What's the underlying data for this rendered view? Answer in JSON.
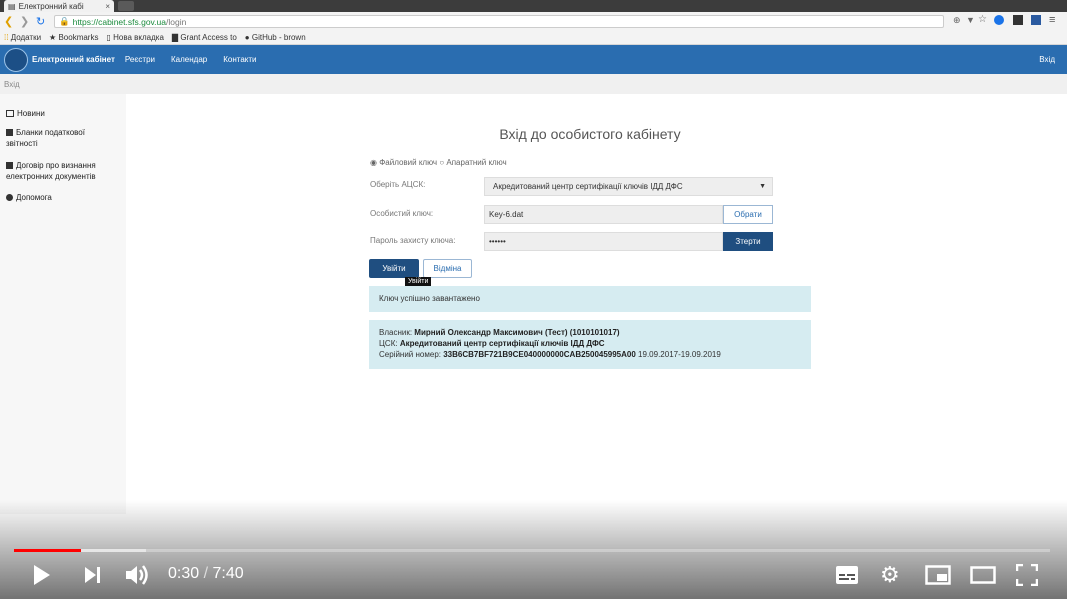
{
  "browser": {
    "tab_title": "Електронний кабі",
    "tab_close": "×",
    "url_host": "https://cabinet.sfs.gov.ua",
    "url_path": "/login",
    "bookmarks": [
      "Додатки",
      "Bookmarks",
      "Нова вкладка",
      "Grant Access to",
      "GitHub - brown"
    ]
  },
  "site": {
    "brand": "Електронний кабінет",
    "nav": [
      "Реєстри",
      "Календар",
      "Контакти"
    ],
    "login_link": "Вхід",
    "breadcrumb": "Вхід"
  },
  "sidebar": {
    "items": [
      {
        "label": "Новини"
      },
      {
        "label": "Бланки податкової звітності"
      },
      {
        "label": "Договір про визнання електронних документів"
      },
      {
        "label": "Допомога"
      }
    ]
  },
  "form": {
    "title": "Вхід до особистого кабінету",
    "radio_file": "Файловий ключ",
    "radio_hw": "Апаратний ключ",
    "acsk_label": "Оберіть АЦСК:",
    "acsk_value": "Акредитований центр сертифікації ключів ІДД ДФС",
    "key_label": "Особистий ключ:",
    "key_value": "Key-6.dat",
    "choose_btn": "Обрати",
    "pwd_label": "Пароль захисту ключа:",
    "pwd_value": "••••••",
    "erase_btn": "Зтерти",
    "login_btn": "Увійти",
    "cancel_btn": "Відміна",
    "tooltip": "Увійти"
  },
  "alerts": {
    "success": "Ключ успішно завантажено",
    "owner_label": "Власник:",
    "owner_value": "Мирний Олександр Максимович (Тест) (1010101017)",
    "csk_label": "ЦСК:",
    "csk_value": "Акредитований центр сертифікації ключів ІДД ДФС",
    "serial_label": "Серійний номер:",
    "serial_value": "33B6CB7BF721B9CE040000000CAB250045995A00",
    "validity": "19.09.2017-19.09.2019"
  },
  "video": {
    "current_time": "0:30",
    "separator": "/",
    "duration": "7:40",
    "progress_fraction": 0.065,
    "loaded_fraction": 0.127
  }
}
